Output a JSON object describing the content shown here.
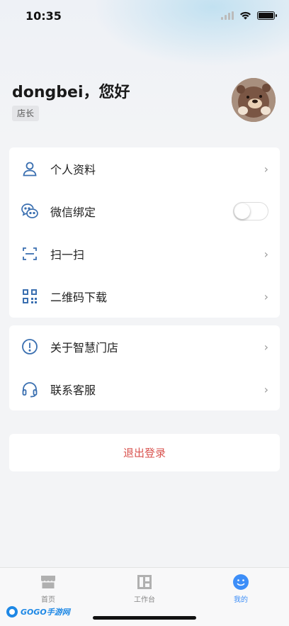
{
  "status_bar": {
    "time": "10:35"
  },
  "profile": {
    "greeting": "dongbei，您好",
    "role": "店长"
  },
  "menu_group_1": [
    {
      "icon": "user-icon",
      "label": "个人资料",
      "action": "chevron"
    },
    {
      "icon": "wechat-icon",
      "label": "微信绑定",
      "action": "toggle",
      "toggle_on": false
    },
    {
      "icon": "scan-icon",
      "label": "扫一扫",
      "action": "chevron"
    },
    {
      "icon": "qr-code-icon",
      "label": "二维码下载",
      "action": "chevron"
    }
  ],
  "menu_group_2": [
    {
      "icon": "info-icon",
      "label": "关于智慧门店",
      "action": "chevron"
    },
    {
      "icon": "headset-icon",
      "label": "联系客服",
      "action": "chevron"
    }
  ],
  "logout_label": "退出登录",
  "tabs": [
    {
      "icon": "store-icon",
      "label": "首页",
      "active": false
    },
    {
      "icon": "workbench-icon",
      "label": "工作台",
      "active": false
    },
    {
      "icon": "smile-icon",
      "label": "我的",
      "active": true
    }
  ],
  "colors": {
    "accent": "#3d8ef8",
    "icon_blue": "#3a6fb0",
    "logout_red": "#d9534f"
  },
  "watermark": "GOGO手游网"
}
